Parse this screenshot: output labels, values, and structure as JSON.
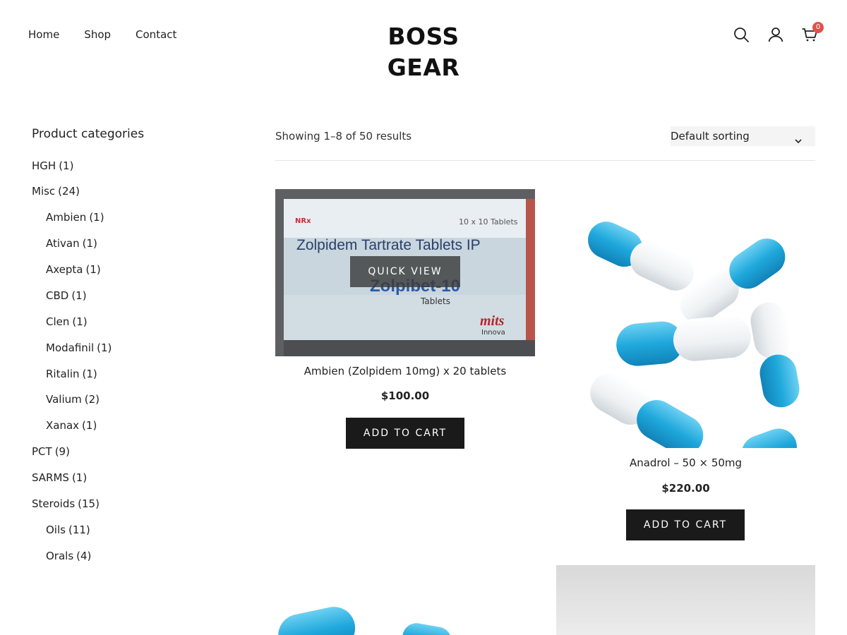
{
  "header": {
    "nav": [
      "Home",
      "Shop",
      "Contact"
    ],
    "logo": "BOSS GEAR",
    "cart_count": "0"
  },
  "sidebar": {
    "title": "Product categories",
    "categories": [
      {
        "name": "HGH",
        "count": "(1)"
      },
      {
        "name": "Misc",
        "count": "(24)"
      },
      {
        "name": "Ambien",
        "count": "(1)"
      },
      {
        "name": "Ativan",
        "count": "(1)"
      },
      {
        "name": "Axepta",
        "count": "(1)"
      },
      {
        "name": "CBD",
        "count": "(1)"
      },
      {
        "name": "Clen",
        "count": "(1)"
      },
      {
        "name": "Modafinil",
        "count": "(1)"
      },
      {
        "name": "Ritalin",
        "count": "(1)"
      },
      {
        "name": "Valium",
        "count": "(2)"
      },
      {
        "name": "Xanax",
        "count": "(1)"
      },
      {
        "name": "PCT",
        "count": "(9)"
      },
      {
        "name": "SARMS",
        "count": "(1)"
      },
      {
        "name": "Steroids",
        "count": "(15)"
      },
      {
        "name": "Oils",
        "count": "(11)"
      },
      {
        "name": "Orals",
        "count": "(4)"
      }
    ]
  },
  "toolbar": {
    "result_count": "Showing 1–8 of 50 results",
    "sort_selected": "Default sorting"
  },
  "products": [
    {
      "title": "Ambien (Zolpidem 10mg) x 20 tablets",
      "price": "$100.00",
      "button": "ADD TO CART",
      "quick_view": "QUICK VIEW",
      "box_text": {
        "header": "10 x 10 Tablets",
        "rx": "NRx",
        "line1": "Zolpidem Tartrate Tablets IP",
        "brand": "Zolpibet-10",
        "tablets": "Tablets",
        "maker": "mits",
        "maker_sub": "Innova"
      }
    },
    {
      "title": "Anadrol – 50 × 50mg",
      "price": "$220.00",
      "button": "ADD TO CART"
    }
  ],
  "colors": {
    "accent_badge": "#e2514a",
    "button_bg": "#1a1a1a",
    "capsule_blue": "#1fa8dc"
  }
}
